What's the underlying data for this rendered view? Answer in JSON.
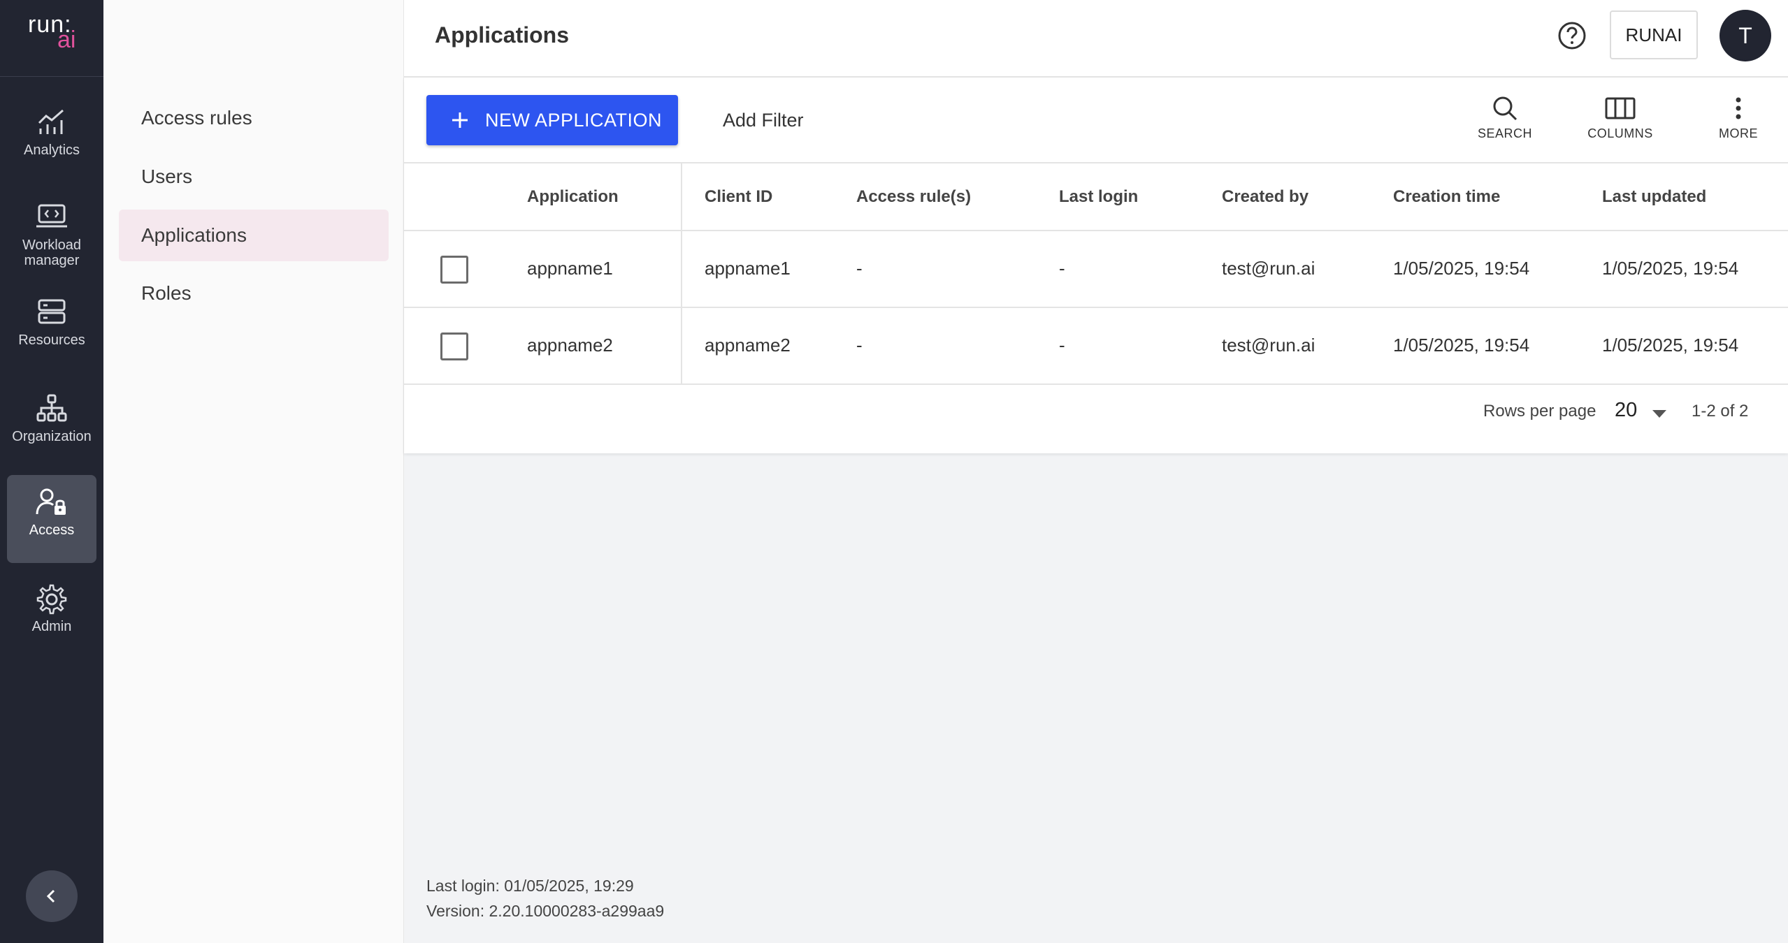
{
  "logo": {
    "part1": "run:",
    "part2": "ai"
  },
  "rail": {
    "items": [
      {
        "label": "Analytics",
        "icon": "analytics-icon"
      },
      {
        "label": "Workload manager",
        "icon": "workload-icon"
      },
      {
        "label": "Resources",
        "icon": "resources-icon"
      },
      {
        "label": "Organization",
        "icon": "organization-icon"
      },
      {
        "label": "Access",
        "icon": "access-icon",
        "active": true
      },
      {
        "label": "Admin",
        "icon": "gear-icon"
      }
    ]
  },
  "subnav": {
    "items": [
      {
        "label": "Access rules"
      },
      {
        "label": "Users"
      },
      {
        "label": "Applications",
        "active": true
      },
      {
        "label": "Roles"
      }
    ]
  },
  "header": {
    "title": "Applications",
    "tenant": "RUNAI",
    "avatar": "T"
  },
  "toolbar": {
    "new_label": "NEW APPLICATION",
    "filter_label": "Add Filter",
    "search_label": "SEARCH",
    "columns_label": "COLUMNS",
    "more_label": "MORE"
  },
  "table": {
    "columns": [
      "Application",
      "Client ID",
      "Access rule(s)",
      "Last login",
      "Created by",
      "Creation time",
      "Last updated"
    ],
    "rows": [
      [
        "appname1",
        "appname1",
        "-",
        "-",
        "test@run.ai",
        "1/05/2025, 19:54",
        "1/05/2025, 19:54"
      ],
      [
        "appname2",
        "appname2",
        "-",
        "-",
        "test@run.ai",
        "1/05/2025, 19:54",
        "1/05/2025, 19:54"
      ]
    ]
  },
  "pager": {
    "rows_per_page_label": "Rows per page",
    "rows_per_page": "20",
    "range": "1-2 of 2"
  },
  "footer": {
    "last_login": "Last login: 01/05/2025, 19:29",
    "version": "Version: 2.20.10000283-a299aa9"
  },
  "colors": {
    "rail_bg": "#222531",
    "primary": "#2d55f0",
    "brand_accent": "#e0529c",
    "active_subnav": "#f5e8ee"
  }
}
